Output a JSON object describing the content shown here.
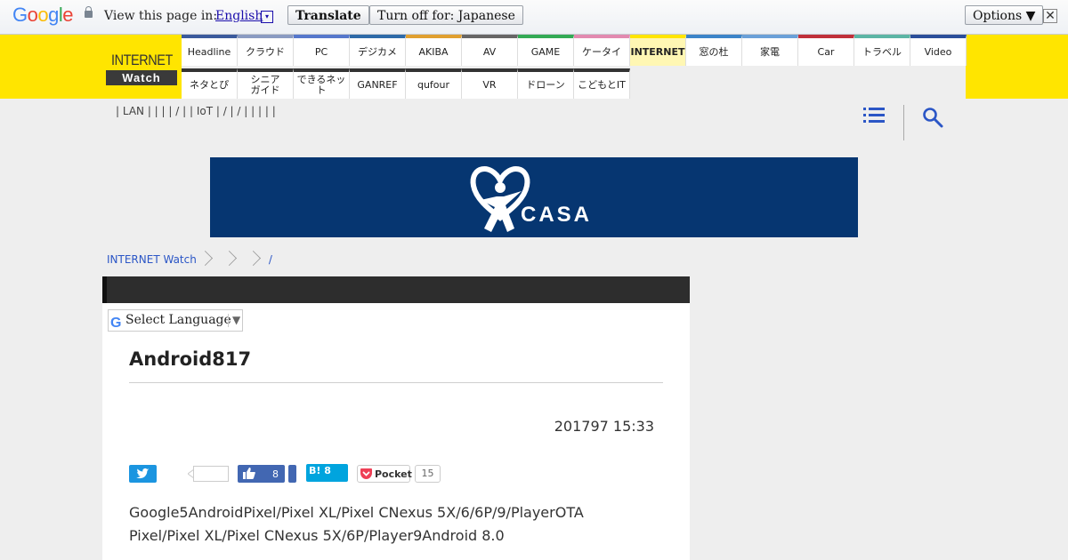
{
  "translate_bar": {
    "logo": "Google",
    "view_text": "View this page in:",
    "language": "English",
    "lang_arrow": "▾",
    "translate_label": "Translate",
    "turn_off_label": "Turn off for: Japanese",
    "options_label": "Options ▼",
    "close_label": "✕"
  },
  "site": {
    "logo_top": "INTERNET",
    "logo_bottom": "Watch"
  },
  "nav": {
    "row1": [
      {
        "label": "Headline",
        "color": "#3a5a9c"
      },
      {
        "label": "クラウド",
        "color": "#8a9bc2"
      },
      {
        "label": "PC",
        "color": "#5577cc"
      },
      {
        "label": "デジカメ",
        "color": "#2d6aa8"
      },
      {
        "label": "AKIBA",
        "color": "#e0a030"
      },
      {
        "label": "AV",
        "color": "#666666"
      },
      {
        "label": "GAME",
        "color": "#33aa55"
      },
      {
        "label": "ケータイ",
        "color": "#e28ab0"
      },
      {
        "label": "INTERNET",
        "color": "#ffe500"
      },
      {
        "label": "窓の杜",
        "color": "#3b84c9"
      },
      {
        "label": "家電",
        "color": "#6aa0d8"
      },
      {
        "label": "Car",
        "color": "#c0303a"
      },
      {
        "label": "トラベル",
        "color": "#5bb5a5"
      },
      {
        "label": "Video",
        "color": "#2a4e9a"
      }
    ],
    "row2": [
      {
        "label": "ネタとぴ"
      },
      {
        "label": "シニア\nガイド"
      },
      {
        "label": "できるネット"
      },
      {
        "label": "GANREF"
      },
      {
        "label": "qufour"
      },
      {
        "label": "VR"
      },
      {
        "label": "ドローン"
      },
      {
        "label": "こどもとIT"
      }
    ]
  },
  "subnav": {
    "text": "|   LAN   |     |     |         |   /   |         |   IoT   |   /   |   /   |     |     |     |     |"
  },
  "banner": {
    "ad_text": "CASA"
  },
  "breadcrumb": {
    "home": "INTERNET Watch",
    "last": "/"
  },
  "article": {
    "select_language": "Select Language",
    "select_caret": "▼",
    "title": "Android817",
    "date": "201797 15:33",
    "fb_count": "8",
    "hatena_label": "B! 8",
    "pocket_label": "Pocket",
    "pocket_count": "15",
    "body": [
      "Google5AndroidPixel/Pixel XL/Pixel CNexus 5X/6/6P/9/PlayerOTA",
      "Pixel/Pixel XL/Pixel CNexus 5X/6P/Player9Android 8.0"
    ]
  }
}
